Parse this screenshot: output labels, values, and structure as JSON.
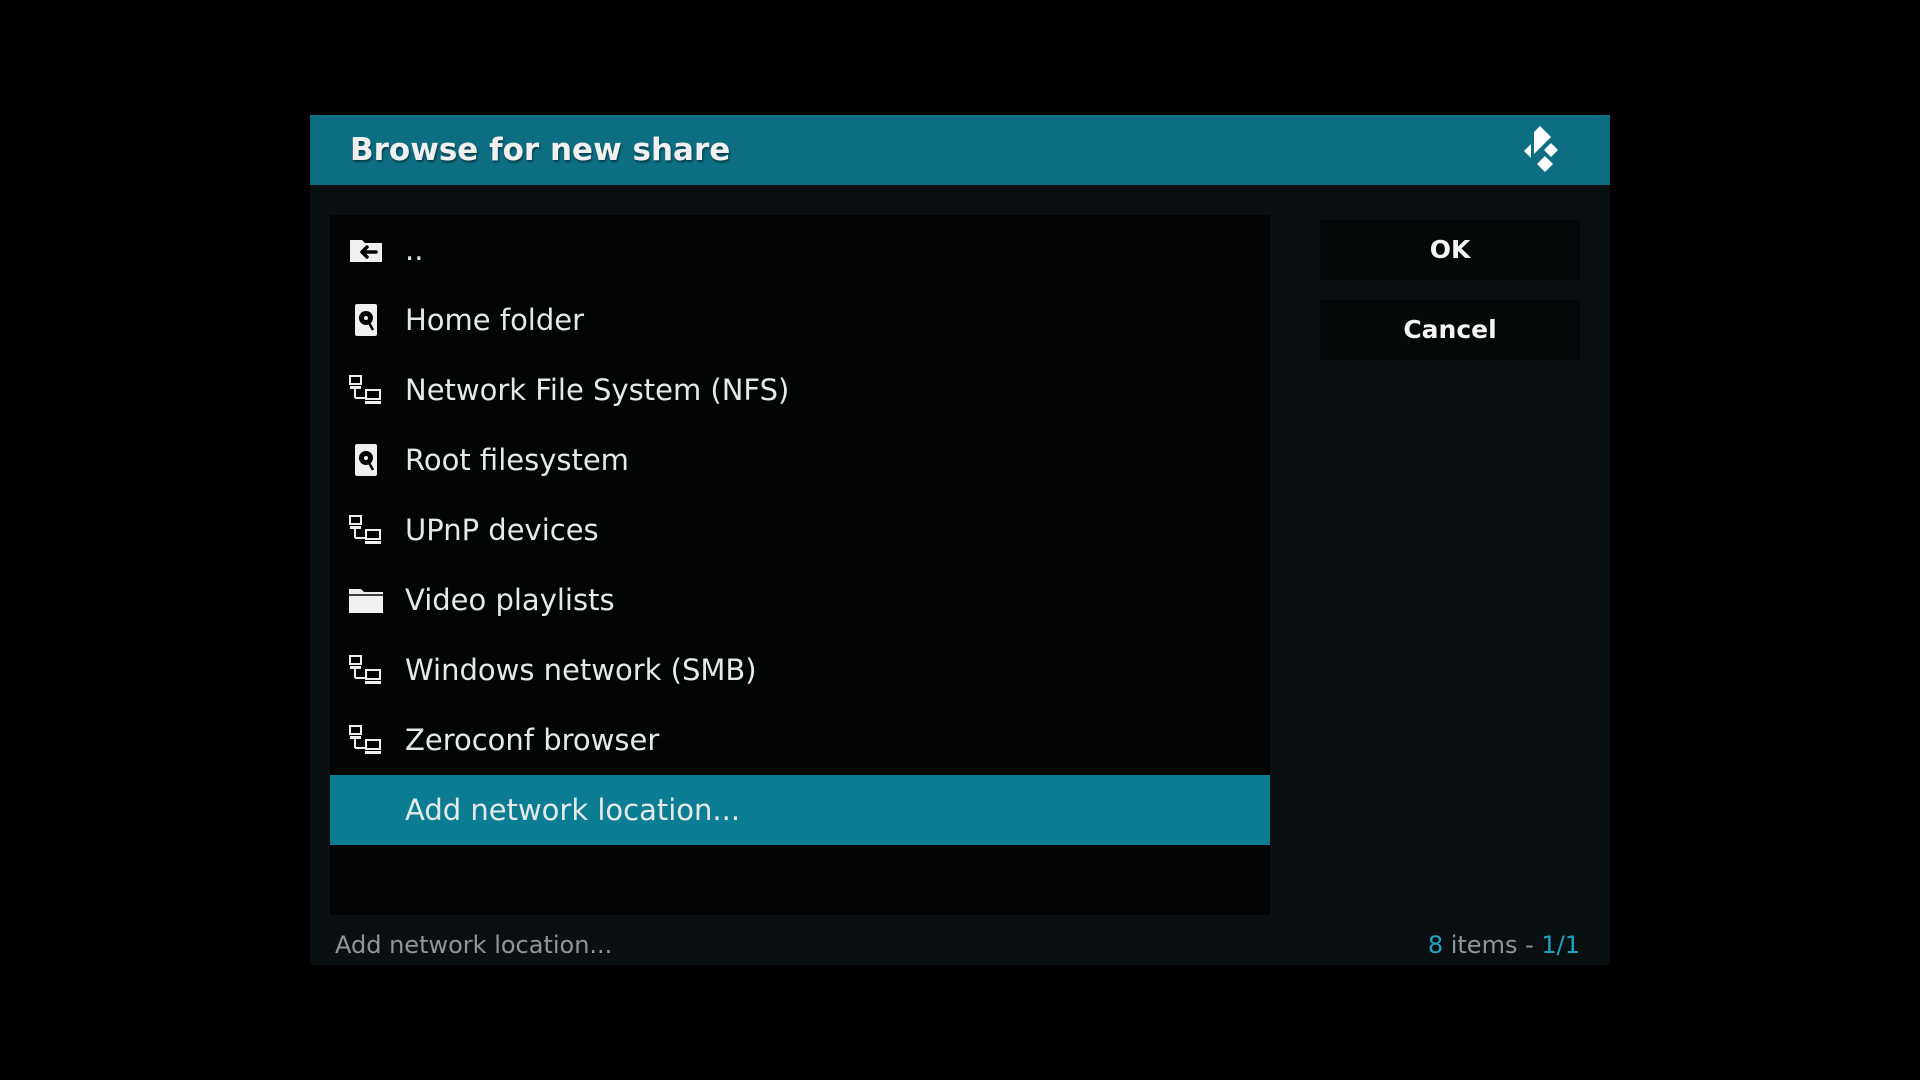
{
  "dialog": {
    "title": "Browse for new share",
    "logo_icon": "kodi-logo-icon"
  },
  "list": {
    "items": [
      {
        "label": "..",
        "icon": "folder-back-icon",
        "selected": false
      },
      {
        "label": "Home folder",
        "icon": "hard-drive-icon",
        "selected": false
      },
      {
        "label": "Network File System (NFS)",
        "icon": "network-icon",
        "selected": false
      },
      {
        "label": "Root filesystem",
        "icon": "hard-drive-icon",
        "selected": false
      },
      {
        "label": "UPnP devices",
        "icon": "network-icon",
        "selected": false
      },
      {
        "label": "Video playlists",
        "icon": "folder-icon",
        "selected": false
      },
      {
        "label": "Windows network (SMB)",
        "icon": "network-icon",
        "selected": false
      },
      {
        "label": "Zeroconf browser",
        "icon": "network-icon",
        "selected": false
      },
      {
        "label": "Add network location...",
        "icon": "",
        "selected": true
      }
    ]
  },
  "buttons": {
    "ok_label": "OK",
    "cancel_label": "Cancel"
  },
  "status": {
    "selected_item": "Add network location...",
    "item_count": "8",
    "items_word": " items - ",
    "page": "1/1"
  },
  "colors": {
    "background": "#000000",
    "dialog_bg": "#0a0f12",
    "titlebar": "#0d6e82",
    "selection": "#0b7d93",
    "accent": "#1fa3c1",
    "list_bg": "#020405"
  }
}
